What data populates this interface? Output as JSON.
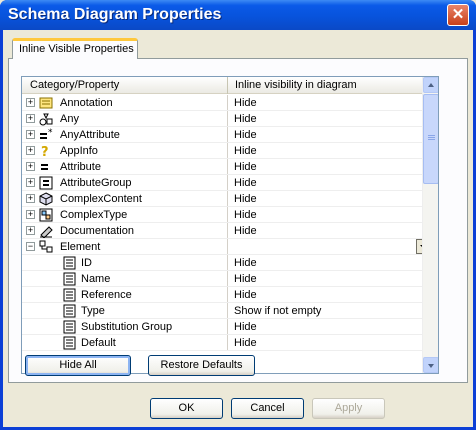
{
  "window": {
    "title": "Schema Diagram Properties",
    "close_glyph": "✕"
  },
  "tabs": [
    {
      "label": "Inline Visible Properties"
    }
  ],
  "grid": {
    "headers": {
      "property": "Category/Property",
      "visibility": "Inline visibility in diagram"
    },
    "rows": [
      {
        "name": "Annotation",
        "value": "Hide",
        "icon": "annotation-icon",
        "expander": "+"
      },
      {
        "name": "Any",
        "value": "Hide",
        "icon": "any-icon",
        "expander": "+"
      },
      {
        "name": "AnyAttribute",
        "value": "Hide",
        "icon": "any-attribute-icon",
        "expander": "+"
      },
      {
        "name": "AppInfo",
        "value": "Hide",
        "icon": "appinfo-icon",
        "expander": "+"
      },
      {
        "name": "Attribute",
        "value": "Hide",
        "icon": "attribute-icon",
        "expander": "+"
      },
      {
        "name": "AttributeGroup",
        "value": "Hide",
        "icon": "attribute-group-icon",
        "expander": "+"
      },
      {
        "name": "ComplexContent",
        "value": "Hide",
        "icon": "complex-content-icon",
        "expander": "+"
      },
      {
        "name": "ComplexType",
        "value": "Hide",
        "icon": "complex-type-icon",
        "expander": "+"
      },
      {
        "name": "Documentation",
        "value": "Hide",
        "icon": "documentation-icon",
        "expander": "+"
      },
      {
        "name": "Element",
        "value": "",
        "icon": "element-icon",
        "expander": "−"
      },
      {
        "name": "ID",
        "value": "Hide",
        "icon": "property-page-icon"
      },
      {
        "name": "Name",
        "value": "Hide",
        "icon": "property-page-icon"
      },
      {
        "name": "Reference",
        "value": "Hide",
        "icon": "property-page-icon"
      },
      {
        "name": "Type",
        "value": "Show if not empty",
        "icon": "property-page-icon"
      },
      {
        "name": "Substitution Group",
        "value": "Hide",
        "icon": "property-page-icon"
      },
      {
        "name": "Default",
        "value": "Hide",
        "icon": "property-page-icon"
      }
    ]
  },
  "buttons": {
    "hide_all": {
      "label": "Hide All"
    },
    "restore_defaults": {
      "label": "Restore Defaults"
    },
    "ok": {
      "label": "OK"
    },
    "cancel": {
      "label": "Cancel"
    },
    "apply": {
      "label": "Apply"
    }
  },
  "colors": {
    "titlebar": "#0853dc",
    "tab_accent": "#ffc83c",
    "dialog_bg": "#ece9d8"
  }
}
